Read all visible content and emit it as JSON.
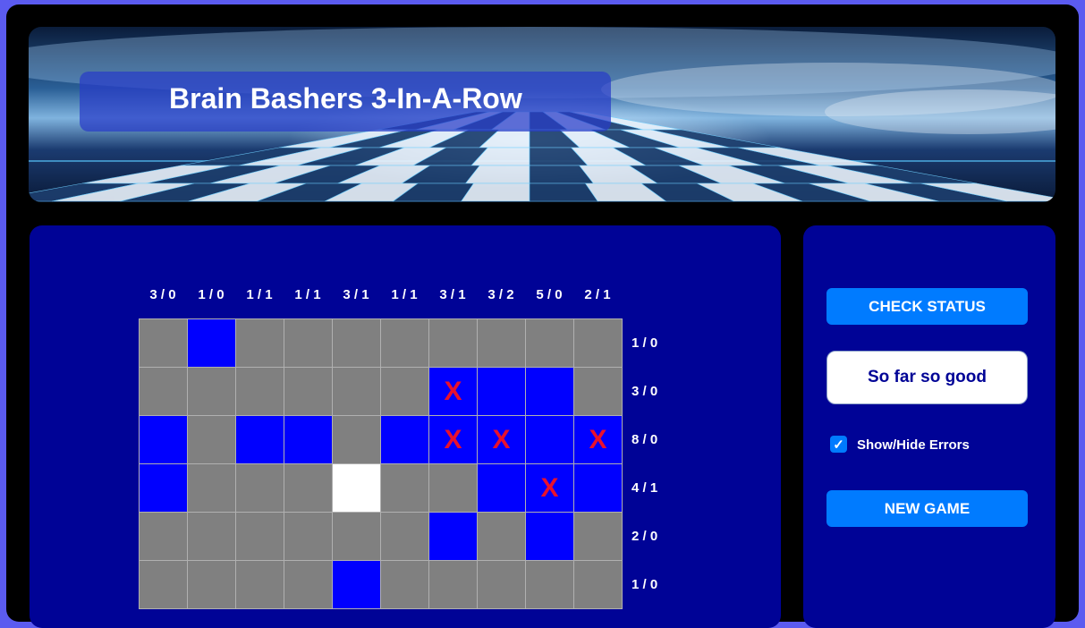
{
  "app": {
    "title": "Brain Bashers 3-In-A-Row"
  },
  "board": {
    "column_clues": [
      "3 / 0",
      "1 / 0",
      "1 / 1",
      "1 / 1",
      "3 / 1",
      "1 / 1",
      "3 / 1",
      "3 / 2",
      "5 / 0",
      "2 / 1"
    ],
    "row_clues": [
      "1 / 0",
      "3 / 0",
      "8 / 0",
      "4 / 1",
      "2 / 0",
      "1 / 0"
    ],
    "cells": [
      [
        {
          "c": "grey",
          "m": ""
        },
        {
          "c": "blue",
          "m": ""
        },
        {
          "c": "grey",
          "m": ""
        },
        {
          "c": "grey",
          "m": ""
        },
        {
          "c": "grey",
          "m": ""
        },
        {
          "c": "grey",
          "m": ""
        },
        {
          "c": "grey",
          "m": ""
        },
        {
          "c": "grey",
          "m": ""
        },
        {
          "c": "grey",
          "m": ""
        },
        {
          "c": "grey",
          "m": ""
        }
      ],
      [
        {
          "c": "grey",
          "m": ""
        },
        {
          "c": "grey",
          "m": ""
        },
        {
          "c": "grey",
          "m": ""
        },
        {
          "c": "grey",
          "m": ""
        },
        {
          "c": "grey",
          "m": ""
        },
        {
          "c": "grey",
          "m": ""
        },
        {
          "c": "blue",
          "m": "X"
        },
        {
          "c": "blue",
          "m": ""
        },
        {
          "c": "blue",
          "m": ""
        },
        {
          "c": "grey",
          "m": ""
        }
      ],
      [
        {
          "c": "blue",
          "m": ""
        },
        {
          "c": "grey",
          "m": ""
        },
        {
          "c": "blue",
          "m": ""
        },
        {
          "c": "blue",
          "m": ""
        },
        {
          "c": "grey",
          "m": ""
        },
        {
          "c": "blue",
          "m": ""
        },
        {
          "c": "blue",
          "m": "X"
        },
        {
          "c": "blue",
          "m": "X"
        },
        {
          "c": "blue",
          "m": ""
        },
        {
          "c": "blue",
          "m": "X"
        }
      ],
      [
        {
          "c": "blue",
          "m": ""
        },
        {
          "c": "grey",
          "m": ""
        },
        {
          "c": "grey",
          "m": ""
        },
        {
          "c": "grey",
          "m": ""
        },
        {
          "c": "white",
          "m": ""
        },
        {
          "c": "grey",
          "m": ""
        },
        {
          "c": "grey",
          "m": ""
        },
        {
          "c": "blue",
          "m": ""
        },
        {
          "c": "blue",
          "m": "X"
        },
        {
          "c": "blue",
          "m": ""
        }
      ],
      [
        {
          "c": "grey",
          "m": ""
        },
        {
          "c": "grey",
          "m": ""
        },
        {
          "c": "grey",
          "m": ""
        },
        {
          "c": "grey",
          "m": ""
        },
        {
          "c": "grey",
          "m": ""
        },
        {
          "c": "grey",
          "m": ""
        },
        {
          "c": "blue",
          "m": ""
        },
        {
          "c": "grey",
          "m": ""
        },
        {
          "c": "blue",
          "m": ""
        },
        {
          "c": "grey",
          "m": ""
        }
      ],
      [
        {
          "c": "grey",
          "m": ""
        },
        {
          "c": "grey",
          "m": ""
        },
        {
          "c": "grey",
          "m": ""
        },
        {
          "c": "grey",
          "m": ""
        },
        {
          "c": "blue",
          "m": ""
        },
        {
          "c": "grey",
          "m": ""
        },
        {
          "c": "grey",
          "m": ""
        },
        {
          "c": "grey",
          "m": ""
        },
        {
          "c": "grey",
          "m": ""
        },
        {
          "c": "grey",
          "m": ""
        }
      ]
    ]
  },
  "controls": {
    "check_status_label": "CHECK STATUS",
    "status_message": "So far so good",
    "show_errors_label": "Show/Hide Errors",
    "show_errors_checked": true,
    "checkmark_glyph": "✓",
    "new_game_label": "NEW GAME"
  },
  "colors": {
    "panel": "#000396",
    "button": "#007bff",
    "cell_blue": "#0000ff",
    "cell_grey": "#808080",
    "error_mark": "#e8112d"
  }
}
